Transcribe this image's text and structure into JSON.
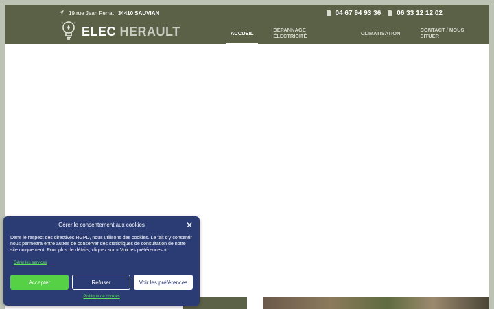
{
  "topbar": {
    "address_street": "19 rue Jean Ferrat",
    "address_city": "34410 SAUVIAN",
    "phone1": "04 67 94 93 36",
    "phone2": "06 33 12 12 02"
  },
  "logo": {
    "word1": "ELEC",
    "word2": "HERAULT"
  },
  "nav": {
    "items": [
      {
        "label": "ACCUEIL"
      },
      {
        "label": "DÉPANNAGE ÉLECTRICITÉ"
      },
      {
        "label": "CLIMATISATION"
      },
      {
        "label": "CONTACT / NOUS SITUER"
      }
    ]
  },
  "cookie": {
    "title": "Gérer le consentement aux cookies",
    "text": "Dans le respect des directives RGPD, nous utilisons des cookies. Le fait d'y consentir nous permettra entre autres de conserver des statistiques de consultation de notre site uniquement. Pour plus de détails, cliquez sur « Voir les préférences ».",
    "services_link": "Gérer les services",
    "accept": "Accepter",
    "refuse": "Refuser",
    "preferences": "Voir les préférences",
    "policy_link": "Politique de cookies"
  },
  "colors": {
    "header": "#5b6147",
    "cookie_bg": "#2b3b73",
    "accept": "#56d045"
  }
}
